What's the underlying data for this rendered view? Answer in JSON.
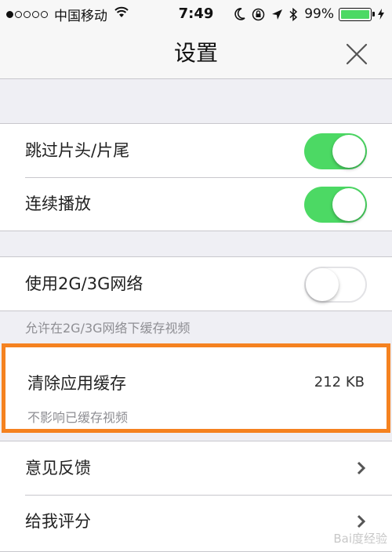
{
  "status_bar": {
    "carrier": "中国移动",
    "time": "7:49",
    "battery": "99%",
    "battery_level": 0.99
  },
  "nav": {
    "title": "设置",
    "close_icon": "close-icon"
  },
  "group1": {
    "items": [
      {
        "label": "跳过片头/片尾",
        "on": true
      },
      {
        "label": "连续播放",
        "on": true
      }
    ]
  },
  "network": {
    "label": "使用2G/3G网络",
    "on": false,
    "note": "允许在2G/3G网络下缓存视频"
  },
  "cache": {
    "label": "清除应用缓存",
    "size": "212 KB",
    "note": "不影响已缓存视频",
    "highlight_color": "#f58220"
  },
  "group3": {
    "items": [
      {
        "label": "意见反馈"
      },
      {
        "label": "给我评分"
      }
    ]
  },
  "watermark": "Bai度经验",
  "colors": {
    "toggle_on": "#4cd964",
    "background": "#efeff4"
  }
}
